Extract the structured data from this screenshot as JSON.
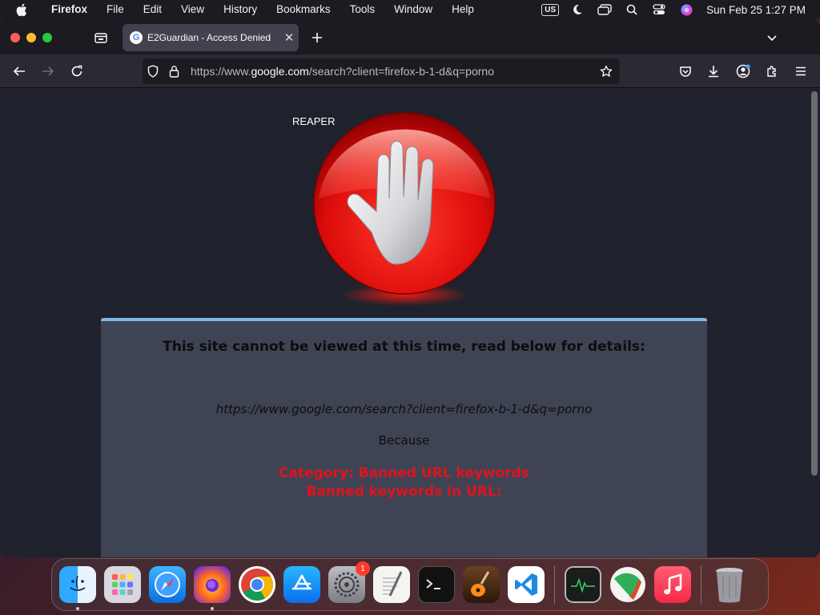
{
  "menubar": {
    "app_name": "Firefox",
    "items": [
      "File",
      "Edit",
      "View",
      "History",
      "Bookmarks",
      "Tools",
      "Window",
      "Help"
    ],
    "input_source": "US",
    "clock": "Sun Feb 25  1:27 PM"
  },
  "browser": {
    "tab": {
      "favicon": "G",
      "title": "E2Guardian - Access Denied"
    },
    "url": {
      "prefix": "https://www.",
      "domain": "google.com",
      "path": "/search?client=firefox-b-1-d&q=porno"
    }
  },
  "page": {
    "brand": "REAPER",
    "headline": "This site cannot be viewed at this time, read below for details:",
    "blocked_url": "https://www.google.com/search?client=firefox-b-1-d&q=porno",
    "because": "Because",
    "category": "Category: Banned URL keywords",
    "reason": "Banned keywords in URL:"
  },
  "dock": {
    "apps": [
      "finder-icon",
      "launchpad-icon",
      "safari-icon",
      "firefox-icon",
      "chrome-icon",
      "app-store-icon",
      "system-settings-icon",
      "textedit-icon",
      "terminal-icon",
      "garageband-icon",
      "vscode-icon",
      "activity-monitor-icon",
      "reaper-icon",
      "music-icon",
      "trash-icon"
    ],
    "settings_badge": "1"
  },
  "colors": {
    "panel_bg": "#3f4454",
    "panel_accent": "#7fb6e6",
    "reason_text": "#e2121d",
    "page_bg": "#1f222c"
  }
}
